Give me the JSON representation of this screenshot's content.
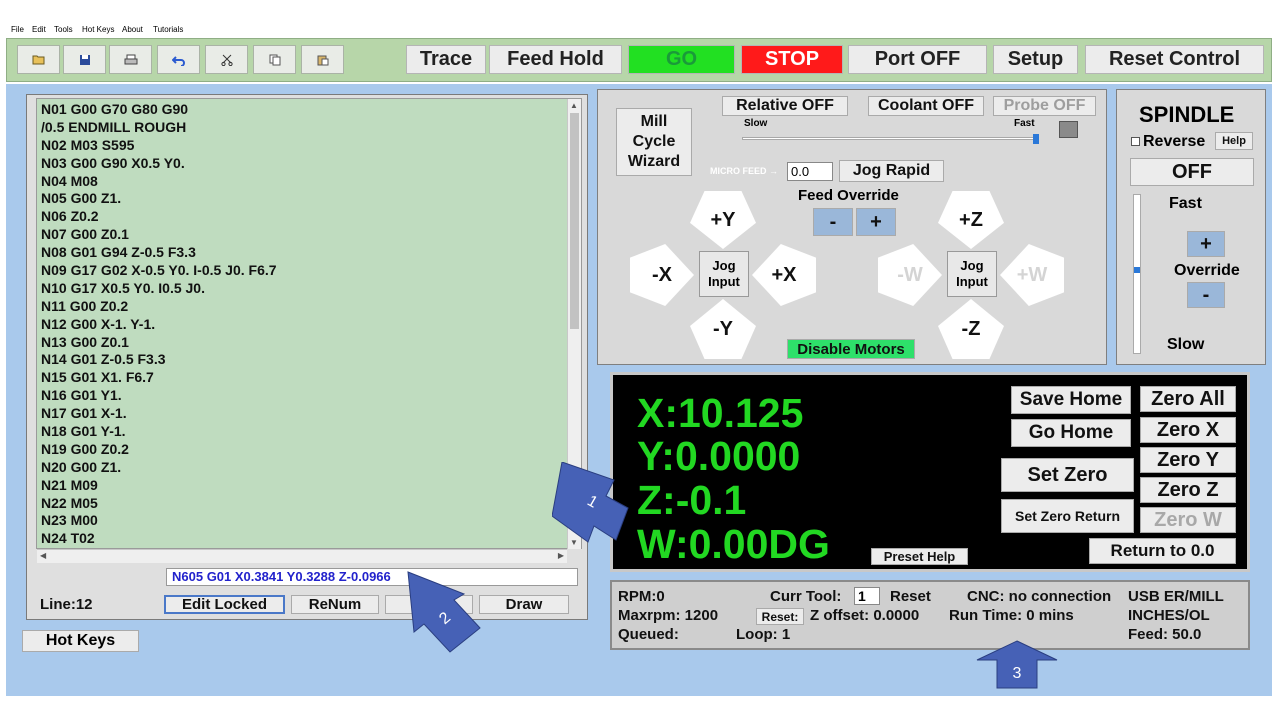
{
  "menu": [
    "File",
    "Edit",
    "Tools",
    "Hot Keys",
    "About",
    "Tutorials"
  ],
  "toolbar": {
    "icons": [
      "folder-open-icon",
      "save-icon",
      "print-icon",
      "undo-icon",
      "cut-icon",
      "copy-icon",
      "paste-icon"
    ],
    "trace": "Trace",
    "feed_hold": "Feed Hold",
    "go": "GO",
    "stop": "STOP",
    "port": "Port OFF",
    "setup": "Setup",
    "reset": "Reset Control",
    "colors": {
      "go_bg": "#22e022",
      "go_fg": "#1a9a3a",
      "stop_bg": "#ff1a1a",
      "stop_fg": "#ffffff"
    }
  },
  "program": {
    "lines": [
      "N01 G00 G70 G80 G90",
      "/0.5 ENDMILL ROUGH",
      "N02 M03 S595",
      "N03 G00 G90 X0.5 Y0.",
      "N04 M08",
      "N05 G00 Z1.",
      "N06 Z0.2",
      "N07 G00 Z0.1",
      "N08 G01 G94 Z-0.5 F3.3",
      "N09 G17 G02 X-0.5 Y0. I-0.5 J0. F6.7",
      "N10 G17 X0.5 Y0. I0.5 J0.",
      "N11 G00 Z0.2",
      "N12 G00 X-1. Y-1.",
      "N13 G00 Z0.1",
      "N14 G01 Z-0.5 F3.3",
      "N15 G01 X1. F6.7",
      "N16 G01 Y1.",
      "N17 G01 X-1.",
      "N18 G01 Y-1.",
      "N19 G00 Z0.2",
      "N20 G00 Z1.",
      "N21 M09",
      "N22 M05",
      "N23 M00",
      "N24 T02"
    ],
    "current_line": "N605 G01 X0.3841 Y0.3288 Z-0.0966",
    "line_label": "Line:12",
    "edit_locked": "Edit Locked",
    "renum": "ReNum",
    "hidden_btn": "",
    "draw": "Draw"
  },
  "hot_keys": "Hot Keys",
  "jog": {
    "mill_cycle_wizard": "Mill Cycle Wizard",
    "relative": "Relative OFF",
    "coolant": "Coolant OFF",
    "probe": "Probe OFF",
    "slow": "Slow",
    "fast": "Fast",
    "micro_feed_label": "MICRO FEED →",
    "micro_feed_value": "0.0",
    "jog_rapid": "Jog Rapid",
    "feed_override": "Feed Override",
    "minus": "-",
    "plus": "+",
    "plus_y": "+Y",
    "minus_y": "-Y",
    "plus_x": "+X",
    "minus_x": "-X",
    "plus_z": "+Z",
    "minus_z": "-Z",
    "plus_w": "+W",
    "minus_w": "-W",
    "jog_input": "Jog Input",
    "disable_motors": "Disable Motors"
  },
  "spindle": {
    "title": "SPINDLE",
    "reverse": "Reverse",
    "help": "Help",
    "state": "OFF",
    "fast": "Fast",
    "plus": "+",
    "override": "Override",
    "minus": "-",
    "slow": "Slow"
  },
  "dro": {
    "x": "X:10.125",
    "y": "Y:0.0000",
    "z": "Z:-0.1",
    "w": "W:0.00DG",
    "save_home": "Save Home",
    "go_home": "Go Home",
    "set_zero": "Set Zero",
    "set_zero_return": "Set Zero Return",
    "preset_help": "Preset Help",
    "zero_all": "Zero All",
    "zero_x": "Zero X",
    "zero_y": "Zero Y",
    "zero_z": "Zero Z",
    "zero_w": "Zero W",
    "return_to_zero": "Return to 0.0"
  },
  "status": {
    "rpm": "RPM:0",
    "maxrpm": "Maxrpm: 1200",
    "queued": "Queued:",
    "curr_tool_label": "Curr Tool:",
    "curr_tool_value": "1",
    "reset": "Reset",
    "reset_btn": "Reset:",
    "z_offset": "Z offset: 0.0000",
    "loop": "Loop: 1",
    "cnc": "CNC: no connection",
    "run_time": "Run Time: 0 mins",
    "usb": "USB ER/MILL",
    "inches": "INCHES/OL",
    "feed": "Feed: 50.0"
  },
  "callouts": [
    "1",
    "2",
    "3"
  ]
}
